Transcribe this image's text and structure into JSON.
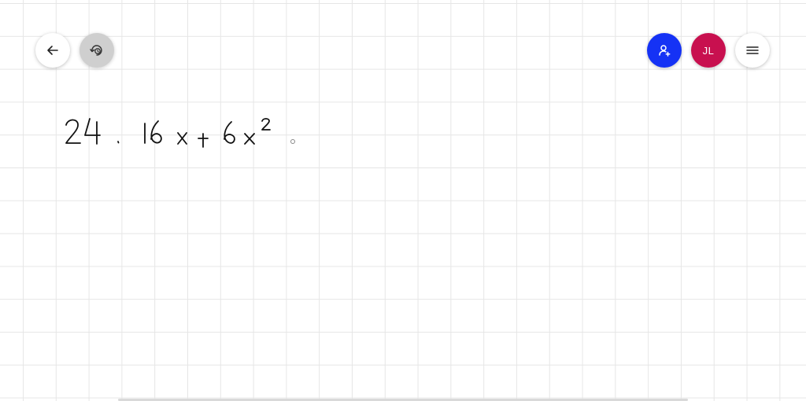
{
  "toolbar_left": {
    "back_icon": "arrow-left-icon",
    "history_icon": "history-icon"
  },
  "toolbar_right": {
    "invite_icon": "add-user-icon",
    "avatar_initials": "JL",
    "menu_icon": "hamburger-menu-icon"
  },
  "canvas": {
    "handwritten_text": "24. 16x+6x²"
  },
  "colors": {
    "invite_button": "#1532f5",
    "avatar": "#c8104f",
    "history_button": "#cfcfcf",
    "grid_line": "#e6e6e6",
    "ink": "#111111"
  }
}
